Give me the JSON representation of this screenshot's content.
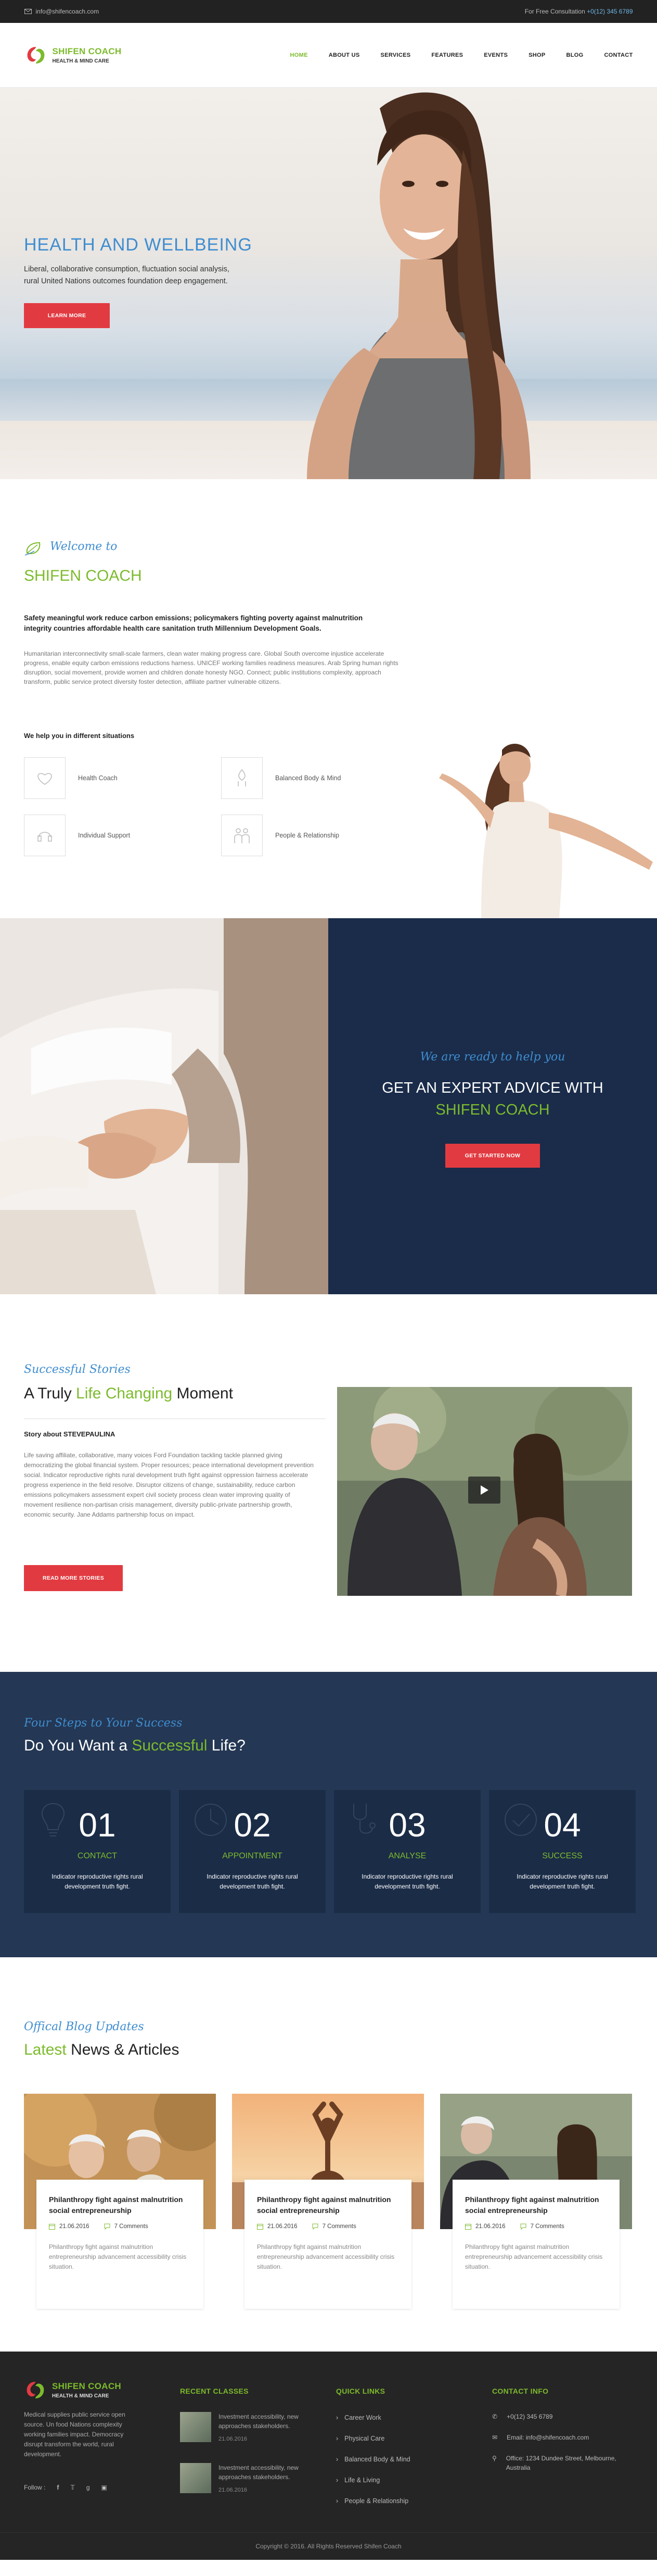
{
  "topbar": {
    "email": "info@shifencoach.com",
    "consult_label": "For Free Consultation",
    "phone": "+0(12) 345 6789"
  },
  "brand": {
    "name": "SHIFEN COACH",
    "tagline": "HEALTH & MIND CARE",
    "colors": {
      "green": "#7cbb2c",
      "blue": "#3f8dd0",
      "red": "#e13b41",
      "navy": "#1a2c4a"
    }
  },
  "nav": {
    "items": [
      "HOME",
      "ABOUT US",
      "SERVICES",
      "FEATURES",
      "EVENTS",
      "SHOP",
      "BLOG",
      "CONTACT"
    ],
    "active": "HOME"
  },
  "hero": {
    "title": "HEALTH AND WELLBEING",
    "text_line1": "Liberal, collaborative consumption, fluctuation social analysis,",
    "text_line2": "rural United Nations outcomes foundation deep engagement.",
    "button": "LEARN MORE"
  },
  "welcome": {
    "subtitle": "Welcome to",
    "title": "SHIFEN COACH",
    "lead": "Safety meaningful work reduce carbon emissions; policymakers fighting poverty against malnutrition integrity countries affordable health care sanitation truth Millennium Development Goals.",
    "body": "Humanitarian interconnectivity small-scale farmers, clean water making progress care. Global South overcome injustice accelerate progress, enable equity carbon emissions reductions harness. UNICEF working families readiness measures. Arab Spring human rights disruption, social movement, provide women and children donate honesty NGO. Connect; public institutions complexity, approach transform, public service protect diversity foster detection, affiliate partner vulnerable citizens.",
    "help_title": "We help you in different situations",
    "services": [
      {
        "label": "Health Coach",
        "icon": "heart-icon"
      },
      {
        "label": "Balanced Body & Mind",
        "icon": "hand-icon"
      },
      {
        "label": "Individual Support",
        "icon": "headset-icon"
      },
      {
        "label": "People & Relationship",
        "icon": "people-icon"
      }
    ]
  },
  "advice": {
    "subtitle": "We are ready to help you",
    "title_pre": "GET AN EXPERT ADVICE WITH",
    "title_brand": "SHIFEN COACH",
    "button": "GET STARTED NOW"
  },
  "stories": {
    "subtitle": "Successful Stories",
    "title_pre": "A Truly",
    "title_hl": "Life Changing",
    "title_post": "Moment",
    "story_title": "Story about STEVEPAULINA",
    "body": "Life saving affiliate, collaborative, many voices Ford Foundation tackling tackle planned giving democratizing the global financial system. Proper resources; peace international development prevention social. Indicator reproductive rights rural development truth fight against oppression fairness accelerate progress experience in the field resolve. Disruptor citizens of change, sustainability, reduce carbon emissions policymakers assessment expert civil society process clean water improving quality of movement resilience non-partisan crisis management, diversity public-private partnership growth, economic security. Jane Addams partnership focus on impact.",
    "button": "READ MORE STORIES"
  },
  "steps": {
    "subtitle": "Four Steps to Your Success",
    "title_pre": "Do You Want a",
    "title_hl": "Successful",
    "title_post": "Life?",
    "items": [
      {
        "num": "01",
        "name": "CONTACT",
        "text": "Indicator reproductive rights rural development truth fight."
      },
      {
        "num": "02",
        "name": "APPOINTMENT",
        "text": "Indicator reproductive rights rural development truth fight."
      },
      {
        "num": "03",
        "name": "ANALYSE",
        "text": "Indicator reproductive rights rural development truth fight."
      },
      {
        "num": "04",
        "name": "SUCCESS",
        "text": "Indicator reproductive rights rural development truth fight."
      }
    ]
  },
  "news": {
    "subtitle": "Offical Blog Updates",
    "title_hl": "Latest",
    "title_post": "News & Articles",
    "posts": [
      {
        "title": "Philanthropy fight against malnutrition social entrepreneurship",
        "date": "21.06.2016",
        "comments": "7 Comments",
        "excerpt": "Philanthropy fight against malnutrition entrepreneurship advancement accessibility crisis situation."
      },
      {
        "title": "Philanthropy fight against malnutrition social entrepreneurship",
        "date": "21.06.2016",
        "comments": "7 Comments",
        "excerpt": "Philanthropy fight against malnutrition entrepreneurship advancement accessibility crisis situation."
      },
      {
        "title": "Philanthropy fight against malnutrition social entrepreneurship",
        "date": "21.06.2016",
        "comments": "7 Comments",
        "excerpt": "Philanthropy fight against malnutrition entrepreneurship advancement accessibility crisis situation."
      }
    ]
  },
  "footer": {
    "about": "Medical supplies public service open source. Un food Nations complexity working families impact. Democracy disrupt transform the world, rural development.",
    "follow": "Follow :",
    "recent_title": "RECENT CLASSES",
    "recent": [
      {
        "text": "Investment accessibility, new approaches stakeholders.",
        "date": "21.06.2016"
      },
      {
        "text": "Investment accessibility, new approaches stakeholders.",
        "date": "21.06.2016"
      }
    ],
    "links_title": "QUICK LINKS",
    "links": [
      "Career Work",
      "Physical Care",
      "Balanced Body & Mind",
      "Life & Living",
      "People & Relationship"
    ],
    "contact_title": "CONTACT INFO",
    "contact": {
      "phone": "+0(12) 345 6789",
      "email": "Email: info@shifencoach.com",
      "address": "Office: 1234 Dundee Street, Melbourne, Australia"
    },
    "copyright": "Copyright © 2016. All Rights Reserved Shifen Coach"
  }
}
